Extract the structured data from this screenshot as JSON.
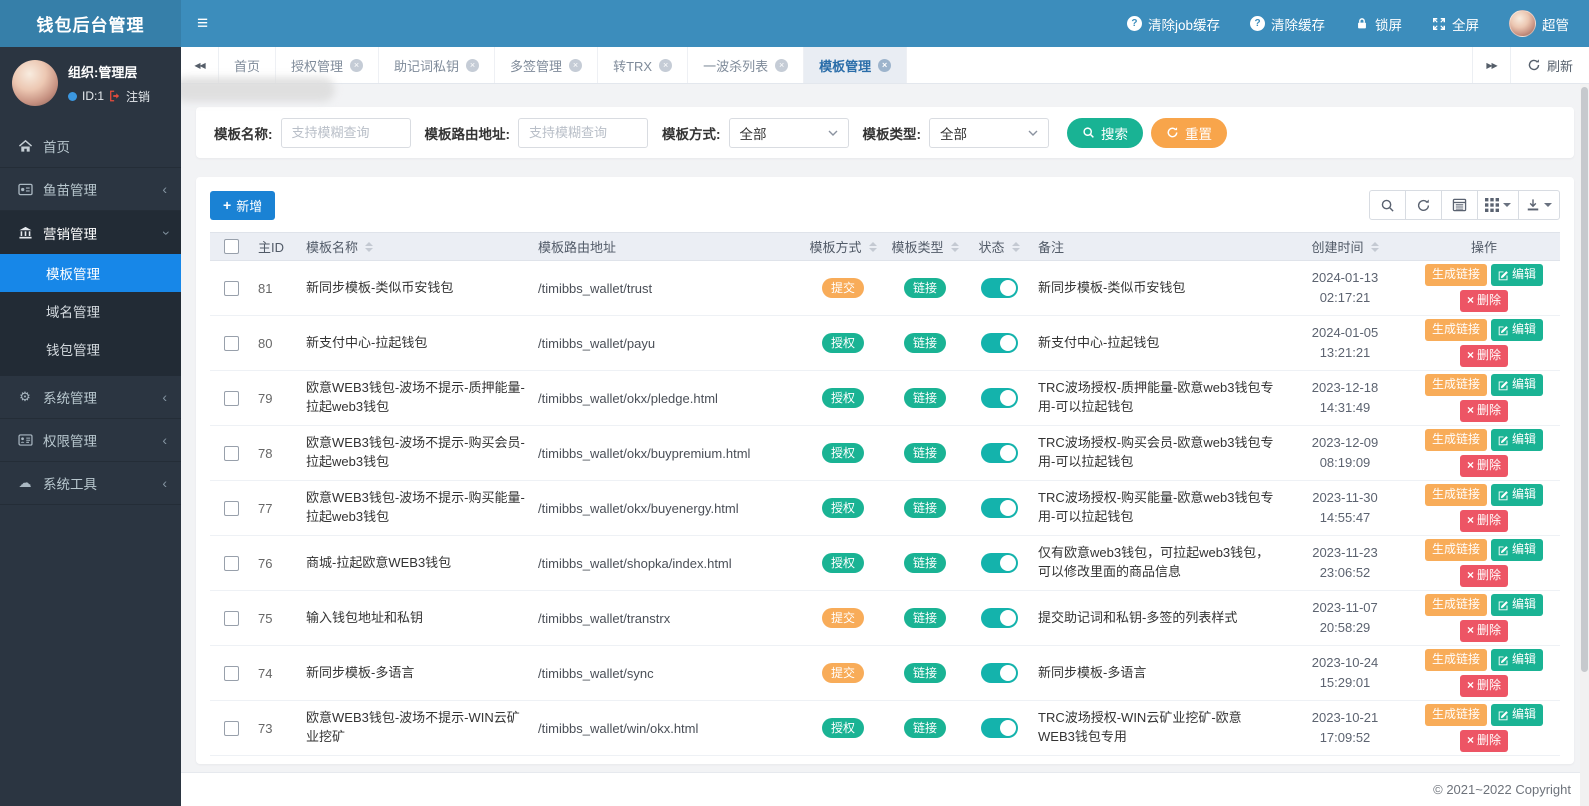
{
  "app_title": "钱包后台管理",
  "topbar": {
    "actions": [
      {
        "label": "清除job缓存"
      },
      {
        "label": "清除缓存"
      },
      {
        "label": "锁屏"
      },
      {
        "label": "全屏"
      }
    ],
    "user_name": "超管"
  },
  "sidebar": {
    "org": "组织:管理层",
    "user_id": "ID:1",
    "logout_label": "注销",
    "menu": [
      {
        "label": "首页"
      },
      {
        "label": "鱼苗管理"
      },
      {
        "label": "营销管理",
        "children": [
          {
            "label": "模板管理"
          },
          {
            "label": "域名管理"
          },
          {
            "label": "钱包管理"
          }
        ]
      },
      {
        "label": "系统管理"
      },
      {
        "label": "权限管理"
      },
      {
        "label": "系统工具"
      }
    ]
  },
  "tabs": {
    "items": [
      {
        "label": "首页",
        "closable": false,
        "active": false
      },
      {
        "label": "授权管理",
        "closable": true,
        "active": false
      },
      {
        "label": "助记词私钥",
        "closable": true,
        "active": false
      },
      {
        "label": "多签管理",
        "closable": true,
        "active": false
      },
      {
        "label": "转TRX",
        "closable": true,
        "active": false
      },
      {
        "label": "一波杀列表",
        "closable": true,
        "active": false
      },
      {
        "label": "模板管理",
        "closable": true,
        "active": true
      }
    ],
    "refresh_label": "刷新"
  },
  "filters": {
    "name_label": "模板名称:",
    "name_placeholder": "支持模糊查询",
    "route_label": "模板路由地址:",
    "route_placeholder": "支持模糊查询",
    "method_label": "模板方式:",
    "method_value": "全部",
    "type_label": "模板类型:",
    "type_value": "全部",
    "search_label": "搜索",
    "reset_label": "重置"
  },
  "toolbar": {
    "add_label": "新增"
  },
  "table": {
    "headers": {
      "id": "主ID",
      "name": "模板名称",
      "route": "模板路由地址",
      "method": "模板方式",
      "type": "模板类型",
      "status": "状态",
      "remark": "备注",
      "created": "创建时间",
      "actions": "操作"
    },
    "actions": {
      "link": "生成链接",
      "edit": "编辑",
      "delete": "删除"
    },
    "rows": [
      {
        "id": "81",
        "name": "新同步模板-类似币安钱包",
        "route": "/timibbs_wallet/trust",
        "method": "提交",
        "method_style": "orange",
        "type": "链接",
        "status": true,
        "remark": "新同步模板-类似币安钱包",
        "created_date": "2024-01-13",
        "created_time": "02:17:21"
      },
      {
        "id": "80",
        "name": "新支付中心-拉起钱包",
        "route": "/timibbs_wallet/payu",
        "method": "授权",
        "method_style": "green",
        "type": "链接",
        "status": true,
        "remark": "新支付中心-拉起钱包",
        "created_date": "2024-01-05",
        "created_time": "13:21:21"
      },
      {
        "id": "79",
        "name": "欧意WEB3钱包-波场不提示-质押能量-拉起web3钱包",
        "route": "/timibbs_wallet/okx/pledge.html",
        "method": "授权",
        "method_style": "green",
        "type": "链接",
        "status": true,
        "remark": "TRC波场授权-质押能量-欧意web3钱包专用-可以拉起钱包",
        "created_date": "2023-12-18",
        "created_time": "14:31:49"
      },
      {
        "id": "78",
        "name": "欧意WEB3钱包-波场不提示-购买会员-拉起web3钱包",
        "route": "/timibbs_wallet/okx/buypremium.html",
        "method": "授权",
        "method_style": "green",
        "type": "链接",
        "status": true,
        "remark": "TRC波场授权-购买会员-欧意web3钱包专用-可以拉起钱包",
        "created_date": "2023-12-09",
        "created_time": "08:19:09"
      },
      {
        "id": "77",
        "name": "欧意WEB3钱包-波场不提示-购买能量-拉起web3钱包",
        "route": "/timibbs_wallet/okx/buyenergy.html",
        "method": "授权",
        "method_style": "green",
        "type": "链接",
        "status": true,
        "remark": "TRC波场授权-购买能量-欧意web3钱包专用-可以拉起钱包",
        "created_date": "2023-11-30",
        "created_time": "14:55:47"
      },
      {
        "id": "76",
        "name": "商城-拉起欧意WEB3钱包",
        "route": "/timibbs_wallet/shopka/index.html",
        "method": "授权",
        "method_style": "green",
        "type": "链接",
        "status": true,
        "remark": "仅有欧意web3钱包，可拉起web3钱包，可以修改里面的商品信息",
        "created_date": "2023-11-23",
        "created_time": "23:06:52"
      },
      {
        "id": "75",
        "name": "输入钱包地址和私钥",
        "route": "/timibbs_wallet/transtrx",
        "method": "提交",
        "method_style": "orange",
        "type": "链接",
        "status": true,
        "remark": "提交助记词和私钥-多签的列表样式",
        "created_date": "2023-11-07",
        "created_time": "20:58:29"
      },
      {
        "id": "74",
        "name": "新同步模板-多语言",
        "route": "/timibbs_wallet/sync",
        "method": "提交",
        "method_style": "orange",
        "type": "链接",
        "status": true,
        "remark": "新同步模板-多语言",
        "created_date": "2023-10-24",
        "created_time": "15:29:01"
      },
      {
        "id": "73",
        "name": "欧意WEB3钱包-波场不提示-WIN云矿业挖矿",
        "route": "/timibbs_wallet/win/okx.html",
        "method": "授权",
        "method_style": "green",
        "type": "链接",
        "status": true,
        "remark": "TRC波场授权-WIN云矿业挖矿-欧意WEB3钱包专用",
        "created_date": "2023-10-21",
        "created_time": "17:09:52"
      }
    ]
  },
  "footer": {
    "copyright": "© 2021~2022 Copyright"
  },
  "colors": {
    "header_blue": "#3c8dbc",
    "active_blue": "#1787e8",
    "green": "#1ab394",
    "orange": "#f8ac59",
    "red": "#ed5565",
    "add_blue": "#1a82d4",
    "toggle_teal": "#14b3ac"
  }
}
